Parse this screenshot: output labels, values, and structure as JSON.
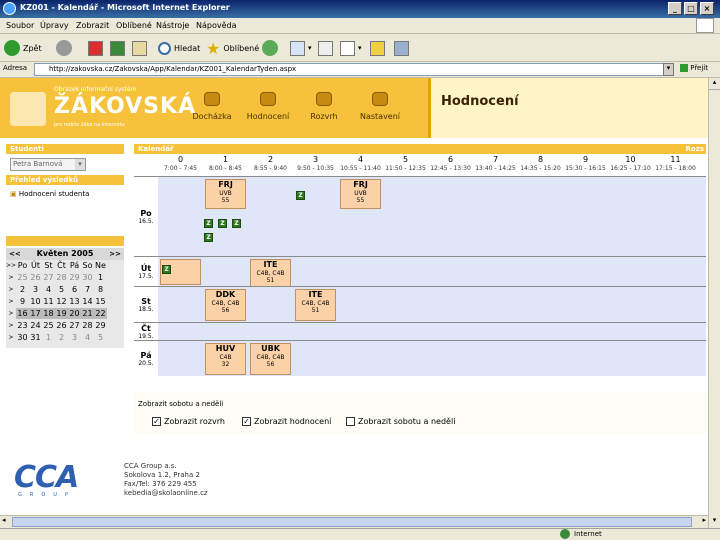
{
  "window": {
    "title": "KZ001 - Kalendář - Microsoft Internet Explorer"
  },
  "menu": [
    "Soubor",
    "Úpravy",
    "Zobrazit",
    "Oblíbené",
    "Nástroje",
    "Nápověda"
  ],
  "toolbar": {
    "back": "Zpět",
    "search": "Hledat",
    "favorites": "Oblíbené"
  },
  "address": {
    "label": "Adresa",
    "url": "http://zakovska.cz/Zakovska/App/Kalendar/KZ001_KalendarTyden.aspx",
    "go": "Přejít"
  },
  "brand": {
    "subtitle": "Obrázek informační systém",
    "name": "ŽÁKOVSKÁ",
    "tagline": "pro rodiče žáka na internetu",
    "accent": "#f7c23b"
  },
  "nav": [
    "Docházka",
    "Hodnocení",
    "Rozvrh",
    "Nastavení"
  ],
  "page_title": "Hodnocení",
  "sidebar": {
    "student_head": "Studenti",
    "student_select": "Petra Barnová",
    "overview_head": "Přehled výsledků",
    "link": "Hodnocení studenta",
    "calendar_title": "Květen 2005",
    "weekdays": [
      "Po",
      "Út",
      "St",
      "Čt",
      "Pá",
      "So",
      "Ne"
    ],
    "weeks": [
      [
        "25",
        "26",
        "27",
        "28",
        "29",
        "30",
        "1"
      ],
      [
        "2",
        "3",
        "4",
        "5",
        "6",
        "7",
        "8"
      ],
      [
        "9",
        "10",
        "11",
        "12",
        "13",
        "14",
        "15"
      ],
      [
        "16",
        "17",
        "18",
        "19",
        "20",
        "21",
        "22"
      ],
      [
        "23",
        "24",
        "25",
        "26",
        "27",
        "28",
        "29"
      ],
      [
        "30",
        "31",
        "1",
        "2",
        "3",
        "4",
        "5"
      ]
    ]
  },
  "calendar": {
    "head": "Kalendář",
    "right": "Rozs",
    "hours": [
      "0",
      "1",
      "2",
      "3",
      "4",
      "5",
      "6",
      "7",
      "8",
      "9",
      "10",
      "11"
    ],
    "times": [
      "7:00 - 7:45",
      "8:00 - 8:45",
      "8:55 - 9:40",
      "9:50 - 10:35",
      "10:55 - 11:40",
      "11:50 - 12:35",
      "12:45 - 13:30",
      "13:40 - 14:25",
      "14:35 - 15:20",
      "15:30 - 16:15",
      "16:25 - 17:10",
      "17:15 - 18:00"
    ],
    "days": [
      {
        "name": "Po",
        "date": "16.5."
      },
      {
        "name": "Út",
        "date": "17.5."
      },
      {
        "name": "St",
        "date": "18.5."
      },
      {
        "name": "Čt",
        "date": "19.5."
      },
      {
        "name": "Pá",
        "date": "20.5."
      }
    ],
    "events": [
      {
        "subj": "FRJ",
        "room": "UVB",
        "num": "55"
      },
      {
        "subj": "FRJ",
        "room": "UVB",
        "num": "55"
      },
      {
        "subj": "ITE",
        "room": "C4B, C4B",
        "num": "51"
      },
      {
        "subj": "DDK",
        "room": "C4B, C4B",
        "num": "56"
      },
      {
        "subj": "ITE",
        "room": "C4B, C4B",
        "num": "51"
      },
      {
        "subj": "HUV",
        "room": "C4B",
        "num": "32"
      },
      {
        "subj": "UBK",
        "room": "C4B, C4B",
        "num": "56"
      }
    ],
    "mark": "Z",
    "show_weekend_link": "Zobrazit sobotu a neděli",
    "options": [
      {
        "label": "Zobrazit rozvrh",
        "checked": true
      },
      {
        "label": "Zobrazit hodnocení",
        "checked": true
      },
      {
        "label": "Zobrazit sobotu a neděli",
        "checked": false
      }
    ]
  },
  "footer": {
    "logo": "CCA",
    "logo_sub": "GROUP",
    "company": "CCA Group a.s.",
    "street": "Sokolova 1.2, Praha 2",
    "phone": "Fax/Tel: 376 229 455",
    "email": "kebedia@skolaonline.cz"
  },
  "status": {
    "zone": "Internet"
  }
}
